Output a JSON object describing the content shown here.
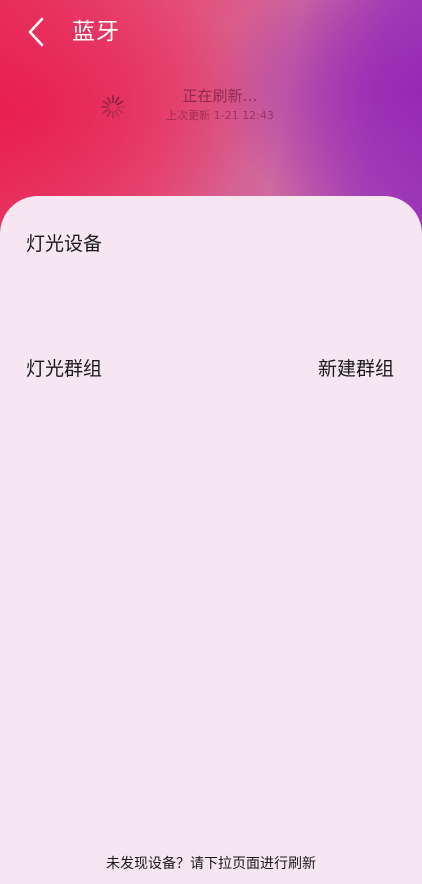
{
  "header": {
    "title": "蓝牙",
    "back_icon": "chevron-left-icon"
  },
  "refresh": {
    "status": "正在刷新…",
    "last_updated": "上次更新 1-21 12:43",
    "icon": "loading-spinner-icon"
  },
  "sections": {
    "devices_title": "灯光设备",
    "groups_title": "灯光群组",
    "new_group_label": "新建群组"
  },
  "footer": {
    "hint": "未发现设备？请下拉页面进行刷新"
  },
  "colors": {
    "header_gradient_start": "#e8325f",
    "header_gradient_end": "#9b36b8",
    "panel_background": "#f6e6f1"
  }
}
